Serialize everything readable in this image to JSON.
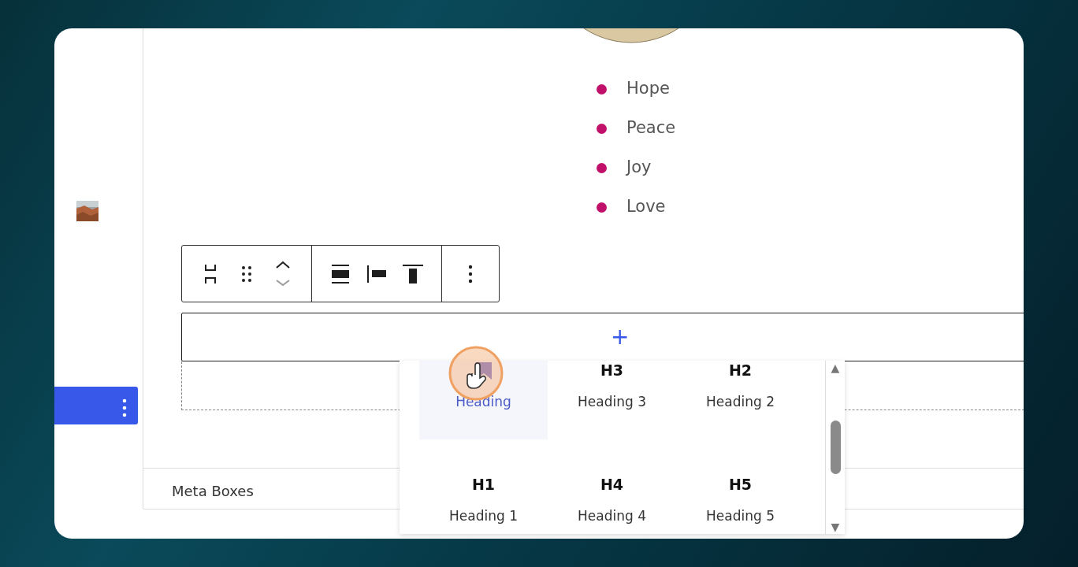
{
  "list": {
    "items": [
      "Hope",
      "Peace",
      "Joy",
      "Love"
    ]
  },
  "toolbar": {
    "groups": [
      {
        "kind": "block"
      },
      {
        "kind": "alignment"
      },
      {
        "kind": "options"
      }
    ]
  },
  "appender": {
    "symbol": "+"
  },
  "sidebar": {
    "items": [
      {
        "kind": "thumbnail",
        "selected": false
      },
      {
        "kind": "bar",
        "selected": true
      }
    ]
  },
  "footer": {
    "label": "Meta Boxes"
  },
  "popup": {
    "items": [
      {
        "kind": "block",
        "label": "Heading",
        "selected": true
      },
      {
        "kind": "level",
        "level_text": "H3",
        "label": "Heading 3",
        "selected": false
      },
      {
        "kind": "level",
        "level_text": "H2",
        "label": "Heading 2",
        "selected": false
      },
      {
        "kind": "level",
        "level_text": "H1",
        "label": "Heading 1",
        "selected": false
      },
      {
        "kind": "level",
        "level_text": "H4",
        "label": "Heading 4",
        "selected": false
      },
      {
        "kind": "level",
        "level_text": "H5",
        "label": "Heading 5",
        "selected": false
      }
    ],
    "scroll": {
      "up": "▲",
      "down": "▼"
    }
  }
}
